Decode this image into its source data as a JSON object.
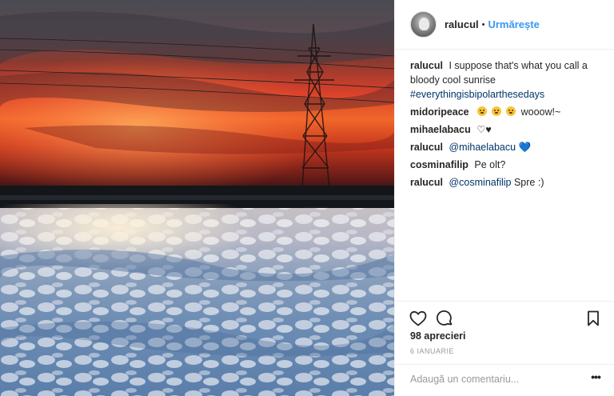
{
  "post": {
    "author": "ralucul",
    "separator": "•",
    "follow_label": "Urmărește",
    "caption": {
      "user": "ralucul",
      "text": "I suppose that's what you call a bloody cool sunrise",
      "hashtag": "#everythingisbipolarthesedays"
    },
    "comments": [
      {
        "user": "midoripeace",
        "text": "wooow!~"
      },
      {
        "user": "mihaelabacu",
        "text": "♡♥"
      },
      {
        "user": "ralucul",
        "mention": "@mihaelabacu",
        "text": "💙"
      },
      {
        "user": "cosminafilip",
        "text": "Pe olt?"
      },
      {
        "user": "ralucul",
        "mention": "@cosminafilip",
        "text": "Spre :)"
      }
    ],
    "likes_label": "98 aprecieri",
    "date_label": "6 IANUARIE",
    "comment_placeholder": "Adaugă un comentariu...",
    "more_label": "•••",
    "icons": {
      "like": "heart-icon",
      "comment": "comment-bubble-icon",
      "save": "bookmark-icon",
      "more": "more-options-icon"
    },
    "colors": {
      "accent": "#3897f0",
      "link": "#003569",
      "text": "#262626",
      "muted": "#999999"
    }
  }
}
